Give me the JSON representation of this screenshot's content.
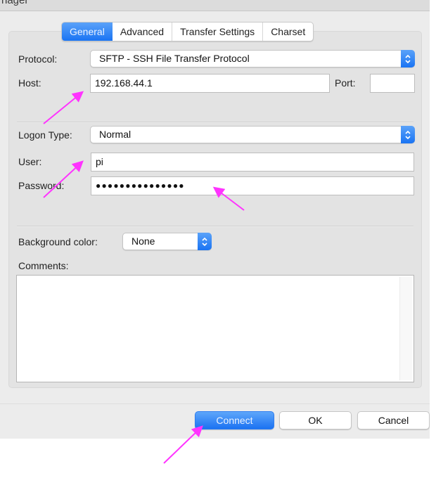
{
  "window": {
    "title_fragment": "nager"
  },
  "tabs": [
    {
      "label": "General",
      "selected": true
    },
    {
      "label": "Advanced",
      "selected": false
    },
    {
      "label": "Transfer Settings",
      "selected": false
    },
    {
      "label": "Charset",
      "selected": false
    }
  ],
  "form": {
    "protocol_label": "Protocol:",
    "protocol_value": "SFTP - SSH File Transfer Protocol",
    "host_label": "Host:",
    "host_value": "192.168.44.1",
    "port_label": "Port:",
    "port_value": "",
    "logon_type_label": "Logon Type:",
    "logon_type_value": "Normal",
    "user_label": "User:",
    "user_value": "pi",
    "password_label": "Password:",
    "password_value": "●●●●●●●●●●●●●●●",
    "background_color_label": "Background color:",
    "background_color_value": "None",
    "comments_label": "Comments:",
    "comments_value": ""
  },
  "buttons": {
    "connect": "Connect",
    "ok": "OK",
    "cancel": "Cancel"
  },
  "colors": {
    "accent": "#1a74f3",
    "annotation": "#ff33ff",
    "window_bg": "#ececec"
  },
  "annotations": [
    {
      "points_to": "host-input"
    },
    {
      "points_to": "user-input"
    },
    {
      "points_to": "password-input"
    },
    {
      "points_to": "connect-button"
    }
  ]
}
